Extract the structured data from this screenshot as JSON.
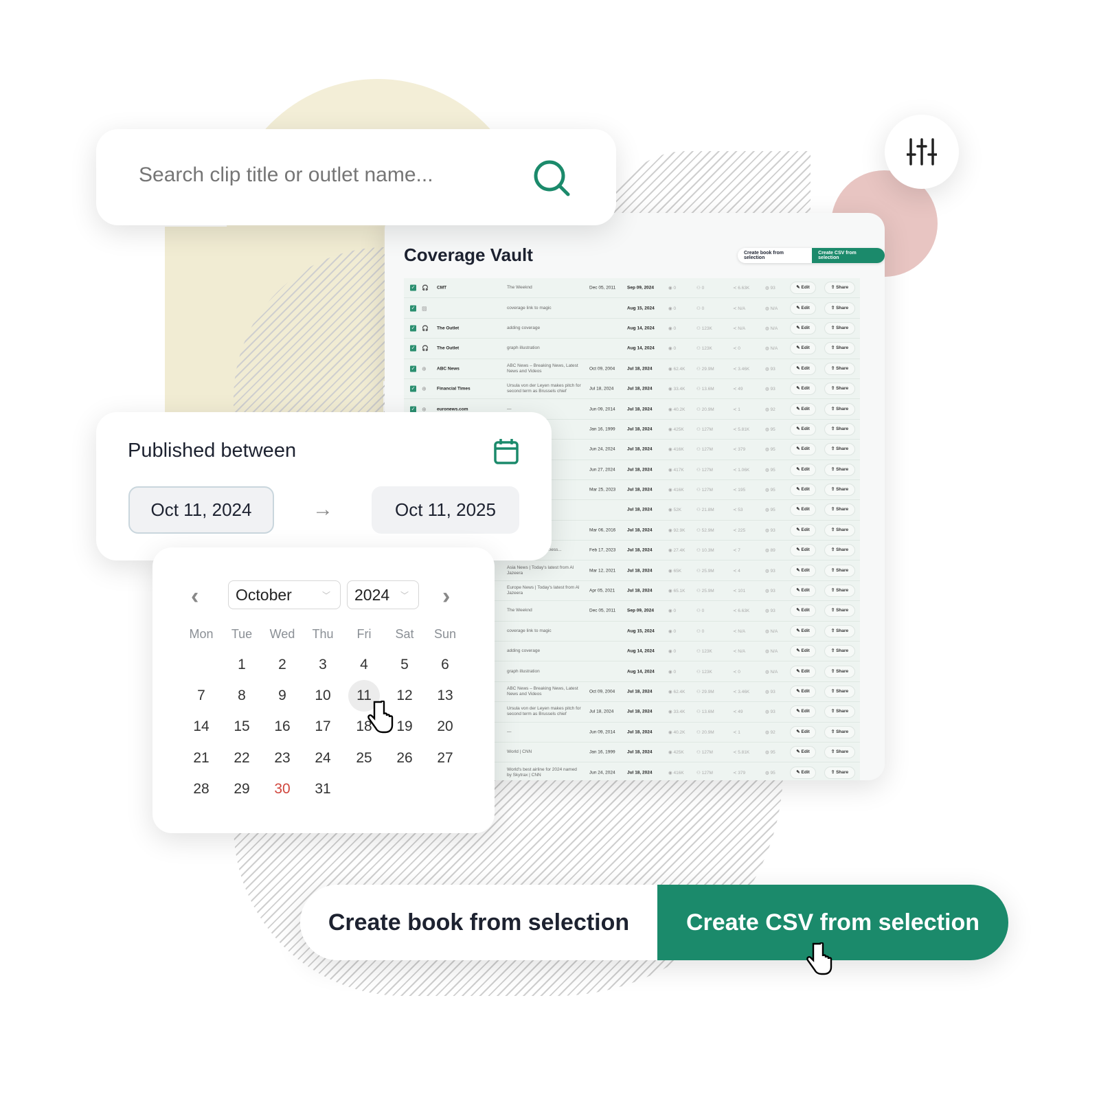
{
  "search": {
    "placeholder": "Search clip title or outlet name...",
    "icon": "search-icon"
  },
  "filter": {
    "icon": "sliders-icon"
  },
  "colors": {
    "accent": "#1b8a6b",
    "weekend_highlight": "#d0463d"
  },
  "vault": {
    "title": "Coverage Vault",
    "create_book_label": "Create book from selection",
    "create_csv_label": "Create CSV from selection",
    "edit_label": "Edit",
    "share_label": "Share",
    "rows": [
      {
        "type": "podcast",
        "outlet": "CMT",
        "title": "The Weeknd",
        "published": "Dec 05, 2011",
        "date": "Sep 09, 2024",
        "views": "0",
        "reach": "0",
        "shares": "6.63K",
        "score": "93"
      },
      {
        "type": "image",
        "outlet": "",
        "title": "coverage link to magic",
        "published": "",
        "date": "Aug 15, 2024",
        "views": "0",
        "reach": "0",
        "shares": "N/A",
        "score": "N/A"
      },
      {
        "type": "podcast",
        "outlet": "The Outlet",
        "title": "adding coverage",
        "published": "",
        "date": "Aug 14, 2024",
        "views": "0",
        "reach": "123K",
        "shares": "N/A",
        "score": "N/A"
      },
      {
        "type": "podcast",
        "outlet": "The Outlet",
        "title": "graph illustration",
        "published": "",
        "date": "Aug 14, 2024",
        "views": "0",
        "reach": "123K",
        "shares": "0",
        "score": "N/A"
      },
      {
        "type": "web",
        "outlet": "ABC News",
        "title": "ABC News – Breaking News, Latest News and Videos",
        "published": "Oct 09, 2004",
        "date": "Jul 18, 2024",
        "views": "62.4K",
        "reach": "29.9M",
        "shares": "3.46K",
        "score": "93"
      },
      {
        "type": "web",
        "outlet": "Financial Times",
        "title": "Ursula von der Leyen makes pitch for second term as Brussels chief",
        "published": "Jul 18, 2024",
        "date": "Jul 18, 2024",
        "views": "33.4K",
        "reach": "13.6M",
        "shares": "49",
        "score": "93"
      },
      {
        "type": "web",
        "outlet": "euronews.com",
        "title": "—",
        "published": "Jun 09, 2014",
        "date": "Jul 18, 2024",
        "views": "40.2K",
        "reach": "20.9M",
        "shares": "1",
        "score": "92"
      },
      {
        "type": "web",
        "outlet": "",
        "title": "",
        "published": "Jan 16, 1999",
        "date": "Jul 18, 2024",
        "views": "425K",
        "reach": "127M",
        "shares": "5.81K",
        "score": "95"
      },
      {
        "type": "web",
        "outlet": "",
        "title": "2024 named",
        "published": "Jun 24, 2024",
        "date": "Jul 18, 2024",
        "views": "416K",
        "reach": "127M",
        "shares": "379",
        "score": "95"
      },
      {
        "type": "web",
        "outlet": "",
        "title": "le cities for",
        "published": "Jun 27, 2024",
        "date": "Jul 18, 2024",
        "views": "417K",
        "reach": "127M",
        "shares": "1.06K",
        "score": "95"
      },
      {
        "type": "web",
        "outlet": "",
        "title": "N",
        "published": "Mar 25, 2023",
        "date": "Jul 18, 2024",
        "views": "416K",
        "reach": "127M",
        "shares": "195",
        "score": "95"
      },
      {
        "type": "web",
        "outlet": "",
        "title": "",
        "published": "",
        "date": "Jul 18, 2024",
        "views": "52K",
        "reach": "21.8M",
        "shares": "53",
        "score": "95"
      },
      {
        "type": "web",
        "outlet": "",
        "title": "s, breaking ries from...",
        "published": "Mar 06, 2016",
        "date": "Jul 18, 2024",
        "views": "92.9K",
        "reach": "52.9M",
        "shares": "225",
        "score": "93"
      },
      {
        "type": "web",
        "outlet": "",
        "title": "ws Today | Top | Business...",
        "published": "Feb 17, 2023",
        "date": "Jul 18, 2024",
        "views": "27.4K",
        "reach": "10.3M",
        "shares": "7",
        "score": "89"
      },
      {
        "type": "web",
        "outlet": "",
        "title": "Asia News | Today's latest from Al Jazeera",
        "published": "Mar 12, 2021",
        "date": "Jul 18, 2024",
        "views": "65K",
        "reach": "25.9M",
        "shares": "4",
        "score": "93"
      },
      {
        "type": "web",
        "outlet": "",
        "title": "Europe News | Today's latest from Al Jazeera",
        "published": "Apr 05, 2021",
        "date": "Jul 18, 2024",
        "views": "65.1K",
        "reach": "25.9M",
        "shares": "101",
        "score": "93"
      },
      {
        "type": "podcast",
        "outlet": "",
        "title": "The Weeknd",
        "published": "Dec 05, 2011",
        "date": "Sep 09, 2024",
        "views": "0",
        "reach": "0",
        "shares": "6.63K",
        "score": "93"
      },
      {
        "type": "image",
        "outlet": "",
        "title": "coverage link to magic",
        "published": "",
        "date": "Aug 15, 2024",
        "views": "0",
        "reach": "0",
        "shares": "N/A",
        "score": "N/A"
      },
      {
        "type": "podcast",
        "outlet": "",
        "title": "adding coverage",
        "published": "",
        "date": "Aug 14, 2024",
        "views": "0",
        "reach": "123K",
        "shares": "N/A",
        "score": "N/A"
      },
      {
        "type": "podcast",
        "outlet": "",
        "title": "graph illustration",
        "published": "",
        "date": "Aug 14, 2024",
        "views": "0",
        "reach": "123K",
        "shares": "0",
        "score": "N/A"
      },
      {
        "type": "web",
        "outlet": "",
        "title": "ABC News – Breaking News, Latest News and Videos",
        "published": "Oct 09, 2004",
        "date": "Jul 18, 2024",
        "views": "62.4K",
        "reach": "29.9M",
        "shares": "3.46K",
        "score": "93"
      },
      {
        "type": "web",
        "outlet": "",
        "title": "Ursula von der Leyen makes pitch for second term as Brussels chief",
        "published": "Jul 18, 2024",
        "date": "Jul 18, 2024",
        "views": "33.4K",
        "reach": "13.6M",
        "shares": "49",
        "score": "93"
      },
      {
        "type": "web",
        "outlet": "",
        "title": "—",
        "published": "Jun 09, 2014",
        "date": "Jul 18, 2024",
        "views": "40.2K",
        "reach": "20.9M",
        "shares": "1",
        "score": "92"
      },
      {
        "type": "web",
        "outlet": "",
        "title": "World | CNN",
        "published": "Jan 16, 1999",
        "date": "Jul 18, 2024",
        "views": "425K",
        "reach": "127M",
        "shares": "5.81K",
        "score": "95"
      },
      {
        "type": "web",
        "outlet": "",
        "title": "World's best airline for 2024 named by Skytrax | CNN",
        "published": "Jun 24, 2024",
        "date": "Jul 18, 2024",
        "views": "416K",
        "reach": "127M",
        "shares": "379",
        "score": "95"
      }
    ]
  },
  "published": {
    "title": "Published between",
    "from": "Oct 11, 2024",
    "to": "Oct 11, 2025"
  },
  "calendar": {
    "month": "October",
    "year": "2024",
    "weekdays": [
      "Mon",
      "Tue",
      "Wed",
      "Thu",
      "Fri",
      "Sat",
      "Sun"
    ],
    "first_weekday_index": 1,
    "days_in_month": 31,
    "hovered_day": 11,
    "highlighted_day": 30
  },
  "actions": {
    "create_book_label": "Create book from selection",
    "create_csv_label": "Create CSV from selection"
  }
}
